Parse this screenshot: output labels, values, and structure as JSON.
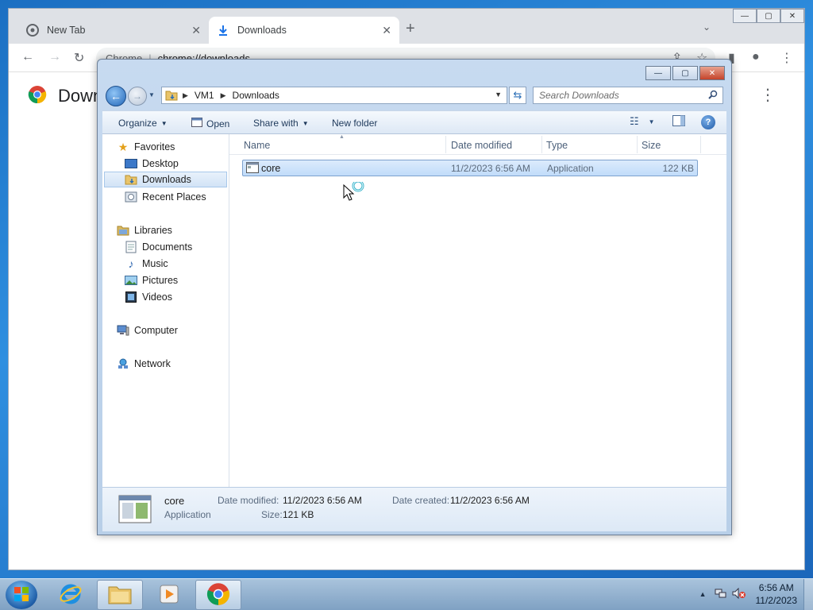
{
  "chrome": {
    "tabs": [
      {
        "label": "New Tab"
      },
      {
        "label": "Downloads"
      }
    ],
    "omnibox": {
      "site_label": "Chrome",
      "url": "chrome://downloads"
    },
    "page_title": "Downloads"
  },
  "explorer": {
    "breadcrumb": [
      "VM1",
      "Downloads"
    ],
    "search_placeholder": "Search Downloads",
    "commands": {
      "organize": "Organize",
      "open": "Open",
      "share_with": "Share with",
      "new_folder": "New folder"
    },
    "nav": {
      "favorites": "Favorites",
      "desktop": "Desktop",
      "downloads": "Downloads",
      "recent_places": "Recent Places",
      "libraries": "Libraries",
      "documents": "Documents",
      "music": "Music",
      "pictures": "Pictures",
      "videos": "Videos",
      "computer": "Computer",
      "network": "Network"
    },
    "columns": {
      "name": "Name",
      "date_modified": "Date modified",
      "type": "Type",
      "size": "Size"
    },
    "files": [
      {
        "name": "core",
        "date_modified": "11/2/2023 6:56 AM",
        "type": "Application",
        "size": "122 KB"
      }
    ],
    "details": {
      "name": "core",
      "type": "Application",
      "date_modified_label": "Date modified:",
      "date_modified": "11/2/2023 6:56 AM",
      "date_created_label": "Date created:",
      "date_created": "11/2/2023 6:56 AM",
      "size_label": "Size:",
      "size": "121 KB"
    }
  },
  "taskbar": {
    "clock_time": "6:56 AM",
    "clock_date": "11/2/2023"
  },
  "colors": {
    "desktop": "#1f7ad0",
    "selection": "#c1dcfa",
    "chrome_tab_strip": "#dee1e6"
  }
}
